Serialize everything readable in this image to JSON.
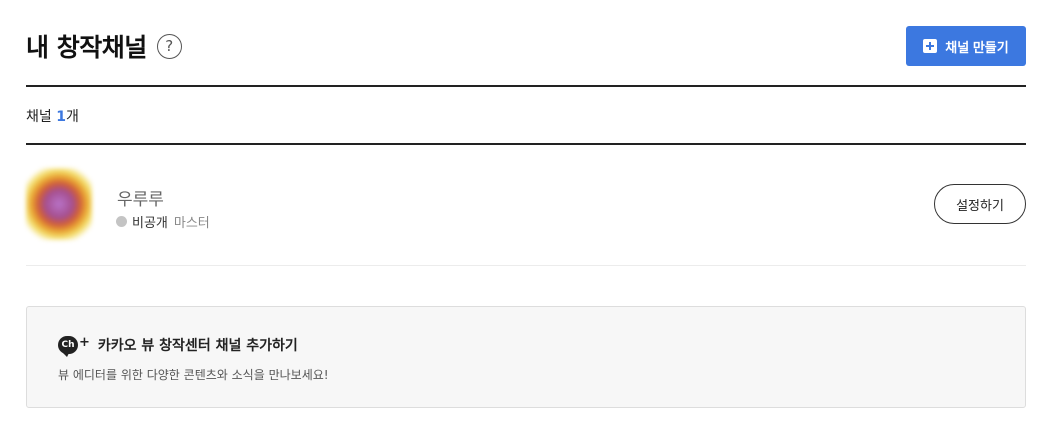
{
  "header": {
    "title": "내 창작채널",
    "help_icon": "?",
    "create_button_label": "채널 만들기"
  },
  "channel_count": {
    "prefix": "채널 ",
    "count": "1",
    "suffix": "개"
  },
  "channels": [
    {
      "name": "우루루",
      "status": "비공개",
      "role": "마스터",
      "settings_label": "설정하기"
    }
  ],
  "promo": {
    "icon_text": "Ch",
    "icon_plus": "+",
    "title": "카카오 뷰 창작센터 채널 추가하기",
    "description": "뷰 에디터를 위한 다양한 콘텐츠와 소식을 만나보세요!"
  },
  "colors": {
    "accent": "#3c78e0",
    "status_dot": "#c4c4c4"
  }
}
